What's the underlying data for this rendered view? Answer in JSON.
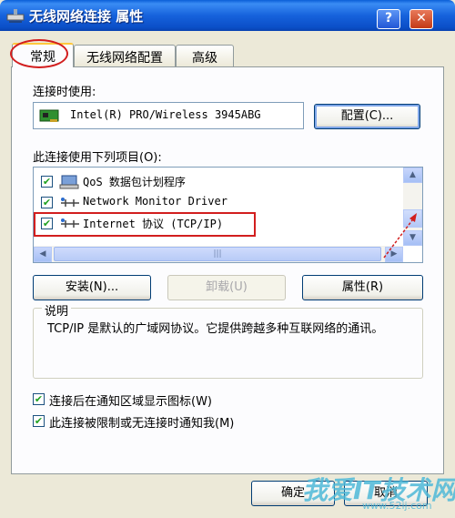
{
  "window": {
    "title": "无线网络连接 属性",
    "help_label": "?",
    "close_label": "✕"
  },
  "tabs": [
    {
      "label": "常规",
      "active": true
    },
    {
      "label": "无线网络配置",
      "active": false
    },
    {
      "label": "高级",
      "active": false
    }
  ],
  "connect_using": {
    "label": "连接时使用:",
    "adapter": "Intel(R) PRO/Wireless 3945ABG",
    "configure_label": "配置(C)..."
  },
  "components": {
    "label": "此连接使用下列项目(O):",
    "items": [
      {
        "label": "QoS 数据包计划程序",
        "checked": true,
        "icon": "qos-scheduler-icon"
      },
      {
        "label": "Network Monitor Driver",
        "checked": true,
        "icon": "network-protocol-icon"
      },
      {
        "label": "Internet 协议 (TCP/IP)",
        "checked": true,
        "icon": "network-protocol-icon"
      }
    ]
  },
  "buttons": {
    "install": "安装(N)...",
    "uninstall": "卸载(U)",
    "properties": "属性(R)"
  },
  "description": {
    "title": "说明",
    "text": "TCP/IP 是默认的广域网协议。它提供跨越多种互联网络的通讯。"
  },
  "options": {
    "show_icon": {
      "label": "连接后在通知区域显示图标(W)",
      "checked": true
    },
    "notify_limited": {
      "label": "此连接被限制或无连接时通知我(M)",
      "checked": true
    }
  },
  "footer": {
    "ok": "确定",
    "cancel": "取消"
  },
  "watermark": {
    "text": "我爱IT技术网",
    "url": "www.52ij.com"
  }
}
